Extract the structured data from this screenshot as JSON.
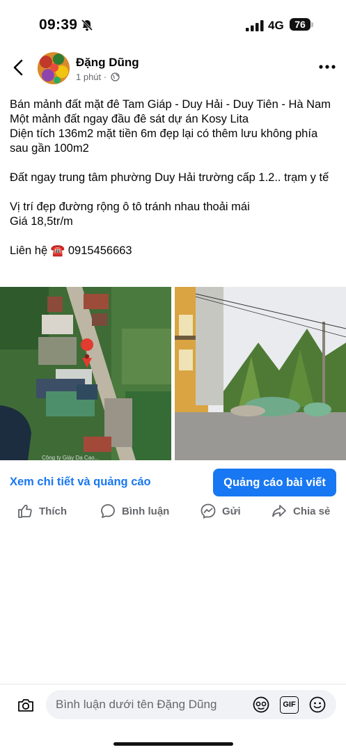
{
  "status": {
    "time": "09:39",
    "network": "4G",
    "battery": "76"
  },
  "post": {
    "author": "Đặng Dũng",
    "time": "1 phút",
    "separator": "·",
    "lines": [
      "Bán mảnh đất mặt đê Tam Giáp - Duy Hải - Duy Tiên - Hà Nam",
      "Một mảnh đất ngay đầu đê sát dự án Kosy Lita",
      "Diện tích 136m2 mặt tiền 6m đẹp lại có thêm lưu không phía sau gần 100m2",
      "Đất ngay trung tâm phường Duy Hải trường cấp 1.2.. trạm y tế",
      "Vị trí đẹp đường rộng ô tô tránh nhau thoải mái",
      "Giá 18,5tr/m",
      "Liên hệ ☎️ 0915456663"
    ],
    "map_credit": "Công ty Giày Da Cao..."
  },
  "cta": {
    "link": "Xem chi tiết và quảng cáo",
    "button": "Quảng cáo bài viết"
  },
  "actions": {
    "like": "Thích",
    "comment": "Bình luận",
    "send": "Gửi",
    "share": "Chia sẻ"
  },
  "comment_bar": {
    "placeholder": "Bình luận dưới tên Đặng Dũng",
    "gif": "GIF"
  },
  "colors": {
    "accent": "#1877f2",
    "secondary_text": "#65676b"
  }
}
